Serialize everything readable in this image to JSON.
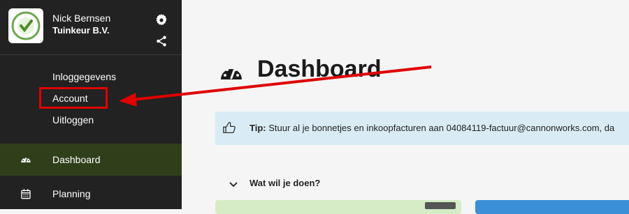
{
  "profile": {
    "user_name": "Nick Bernsen",
    "company_name": "Tuinkeur B.V.",
    "logo_icon": "tuinkeur-gecertificeerd-logo"
  },
  "account_menu": {
    "items": [
      {
        "label": "Inloggegevens"
      },
      {
        "label": "Account"
      },
      {
        "label": "Uitloggen"
      }
    ]
  },
  "nav": {
    "items": [
      {
        "label": "Dashboard",
        "icon": "dashboard-gauge-icon",
        "active": true
      },
      {
        "label": "Planning",
        "icon": "calendar-icon",
        "active": false
      }
    ]
  },
  "main": {
    "title": "Dashboard",
    "tip": {
      "label": "Tip:",
      "text": "Stuur al je bonnetjes en inkoopfacturen aan 04084119-factuur@cannonworks.com, da"
    },
    "section_title": "Wat wil je doen?"
  },
  "colors": {
    "sidebar_bg": "#222222",
    "active_nav_bg": "#2f3f1a",
    "tip_bg": "#d9ecf5",
    "annotation_red": "#e00000",
    "card_green": "#d5ecc6",
    "card_blue": "#3a8fd6"
  }
}
